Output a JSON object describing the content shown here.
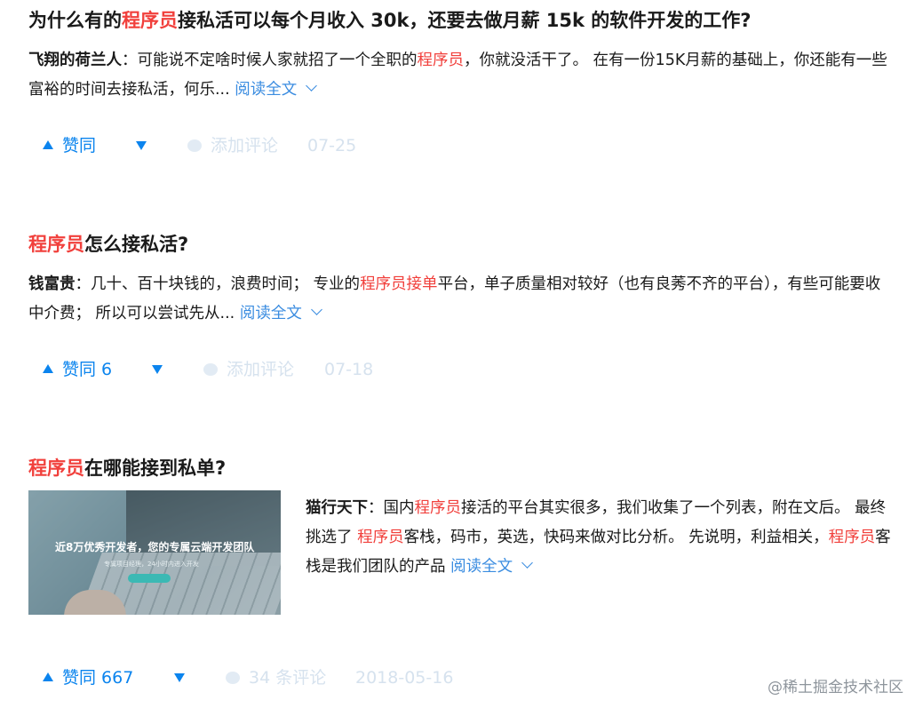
{
  "cards": [
    {
      "title_pre": "为什么有的",
      "title_hl": "程序员",
      "title_post": "接私活可以每个月收入 30k，还要去做月薪 15k 的软件开发的工作?",
      "author": "飞翔的荷兰人",
      "excerpt_a": "：可能说不定啥时候人家就招了一个全职的",
      "excerpt_hl": "程序员",
      "excerpt_b": "，你就没活干了。 在有一份15K月薪的基础上，你还能有一些富裕的时间去接私活，何乐...",
      "read_more": "阅读全文",
      "upvote": "赞同",
      "comment": "添加评论",
      "date": "07-25"
    },
    {
      "title_hl": "程序员",
      "title_post": "怎么接私活?",
      "author": "钱富贵",
      "excerpt_a": "：几十、百十块钱的，浪费时间； 专业的",
      "excerpt_hl": "程序员接单",
      "excerpt_b": "平台，单子质量相对较好（也有良莠不齐的平台），有些可能要收中介费； 所以可以尝试先从...",
      "read_more": "阅读全文",
      "upvote": "赞同 6",
      "comment": "添加评论",
      "date": "07-18"
    },
    {
      "title_hl": "程序员",
      "title_post": "在哪能接到私单?",
      "author": "猫行天下",
      "excerpt_a": "：国内",
      "excerpt_hl": "程序员",
      "excerpt_b": "接活的平台其实很多，我们收集了一个列表，附在文后。 最终挑选了 ",
      "excerpt_hl2": "程序员",
      "excerpt_c": "客栈，码市，英选，快码来做对比分析。 先说明，利益相关，",
      "excerpt_hl3": "程序员",
      "excerpt_d": "客栈是我们团队的产品",
      "read_more": "阅读全文",
      "thumb_text1": "近8万优秀开发者，您的专属云端开发团队",
      "thumb_text2": "专属项目经理，24小时内进入开发",
      "upvote": "赞同 667",
      "comment": "34 条评论",
      "date": "2018-05-16"
    }
  ],
  "watermark": "@稀土掘金技术社区",
  "icons": [
    "upvote-arrow-icon",
    "downvote-arrow-icon",
    "comment-bubble-icon",
    "chevron-down-icon"
  ],
  "colors": {
    "highlight": "#f1403c",
    "link": "#3a8ce0",
    "vote": "#0b84ee",
    "muted": "#d6e2ee"
  }
}
